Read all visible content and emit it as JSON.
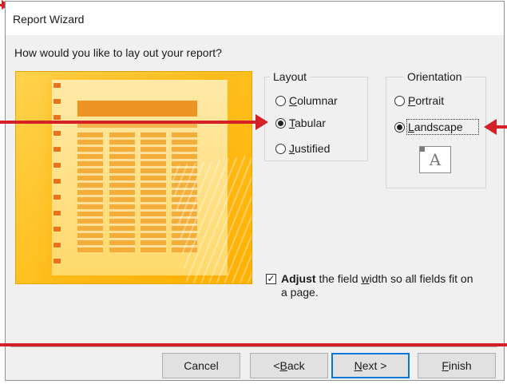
{
  "window": {
    "title": "Report Wizard"
  },
  "prompt": "How would you like to lay out your report?",
  "layout": {
    "legend": "Layout",
    "options": [
      {
        "label": "Columnar",
        "underline": "C",
        "rest": "olumnar",
        "checked": false
      },
      {
        "label": "Tabular",
        "underline": "T",
        "rest": "abular",
        "checked": true
      },
      {
        "label": "Justified",
        "underline": "J",
        "rest": "ustified",
        "checked": false
      }
    ]
  },
  "orientation": {
    "legend": "Orientation",
    "options": [
      {
        "label": "Portrait",
        "underline": "P",
        "rest": "ortrait",
        "checked": false
      },
      {
        "label": "Landscape",
        "underline": "L",
        "rest": "andscape",
        "checked": true
      }
    ],
    "preview_letter": "A"
  },
  "adjust_field_width": {
    "checked": true,
    "bold": "Adjust",
    "pre": " the field ",
    "underline": "w",
    "post": "idth so all fields fit on a page."
  },
  "buttons": {
    "cancel": "Cancel",
    "back_pre": "< ",
    "back_underline": "B",
    "back_post": "ack",
    "next_underline": "N",
    "next_post": "ext >",
    "finish_underline": "F",
    "finish_post": "inish"
  },
  "annotation_color": "#d42127",
  "preview_colors": {
    "background": "#ffbf1f",
    "accent": "#ed9424"
  }
}
